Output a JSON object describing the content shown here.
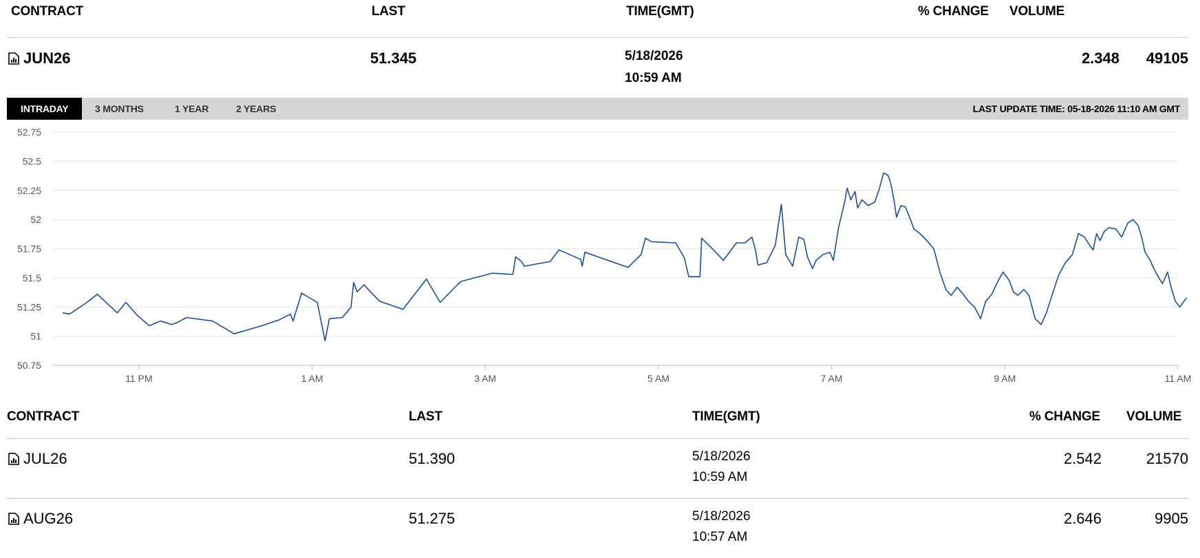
{
  "headers": {
    "contract": "CONTRACT",
    "last": "LAST",
    "time": "TIME(GMT)",
    "change": "% CHANGE",
    "volume": "VOLUME"
  },
  "main": {
    "contract": "JUN26",
    "last": "51.345",
    "date": "5/18/2026",
    "time": "10:59 AM",
    "change": "2.348",
    "volume": "49105"
  },
  "tabs": [
    {
      "label": "INTRADAY",
      "active": true
    },
    {
      "label": "3 MONTHS",
      "active": false
    },
    {
      "label": "1 YEAR",
      "active": false
    },
    {
      "label": "2 YEARS",
      "active": false
    }
  ],
  "last_update": "LAST UPDATE TIME: 05-18-2026 11:10 AM GMT",
  "rows": [
    {
      "contract": "JUL26",
      "last": "51.390",
      "date": "5/18/2026",
      "time": "10:59 AM",
      "change": "2.542",
      "volume": "21570"
    },
    {
      "contract": "AUG26",
      "last": "51.275",
      "date": "5/18/2026",
      "time": "10:57 AM",
      "change": "2.646",
      "volume": "9905"
    }
  ],
  "chart_data": {
    "type": "line",
    "yticks": [
      "52.75",
      "52.5",
      "52.25",
      "52",
      "51.75",
      "51.5",
      "51.25",
      "51",
      "50.75"
    ],
    "ylim": [
      50.75,
      52.75
    ],
    "xticks": [
      {
        "label": "11 PM",
        "t": 23
      },
      {
        "label": "1 AM",
        "t": 25
      },
      {
        "label": "3 AM",
        "t": 27
      },
      {
        "label": "5 AM",
        "t": 29
      },
      {
        "label": "7 AM",
        "t": 31
      },
      {
        "label": "9 AM",
        "t": 33
      },
      {
        "label": "11 AM",
        "t": 35
      }
    ],
    "x_unit": "hour (from previous day midnight GMT)",
    "xlim": [
      22.0,
      35.0
    ],
    "line_color": "#1f4e8c",
    "grid": true,
    "points": [
      [
        22.12,
        51.2
      ],
      [
        22.2,
        51.19
      ],
      [
        22.4,
        51.29
      ],
      [
        22.52,
        51.36
      ],
      [
        22.75,
        51.2
      ],
      [
        22.85,
        51.29
      ],
      [
        22.98,
        51.18
      ],
      [
        23.12,
        51.09
      ],
      [
        23.25,
        51.13
      ],
      [
        23.38,
        51.1
      ],
      [
        23.45,
        51.12
      ],
      [
        23.55,
        51.16
      ],
      [
        23.85,
        51.13
      ],
      [
        24.1,
        51.02
      ],
      [
        24.42,
        51.09
      ],
      [
        24.62,
        51.14
      ],
      [
        24.75,
        51.19
      ],
      [
        24.78,
        51.13
      ],
      [
        24.88,
        51.37
      ],
      [
        25.06,
        51.29
      ],
      [
        25.15,
        50.96
      ],
      [
        25.2,
        51.15
      ],
      [
        25.35,
        51.16
      ],
      [
        25.45,
        51.25
      ],
      [
        25.48,
        51.46
      ],
      [
        25.52,
        51.38
      ],
      [
        25.6,
        51.44
      ],
      [
        25.65,
        51.4
      ],
      [
        25.78,
        51.3
      ],
      [
        26.05,
        51.23
      ],
      [
        26.32,
        51.49
      ],
      [
        26.48,
        51.29
      ],
      [
        26.65,
        51.42
      ],
      [
        26.72,
        51.47
      ],
      [
        27.08,
        51.54
      ],
      [
        27.32,
        51.53
      ],
      [
        27.35,
        51.68
      ],
      [
        27.42,
        51.64
      ],
      [
        27.45,
        51.6
      ],
      [
        27.75,
        51.64
      ],
      [
        27.85,
        51.74
      ],
      [
        28.1,
        51.66
      ],
      [
        28.12,
        51.6
      ],
      [
        28.15,
        51.72
      ],
      [
        28.65,
        51.59
      ],
      [
        28.8,
        51.7
      ],
      [
        28.85,
        51.84
      ],
      [
        28.92,
        51.81
      ],
      [
        29.2,
        51.8
      ],
      [
        29.3,
        51.67
      ],
      [
        29.35,
        51.51
      ],
      [
        29.48,
        51.51
      ],
      [
        29.5,
        51.84
      ],
      [
        29.65,
        51.73
      ],
      [
        29.75,
        51.65
      ],
      [
        29.9,
        51.8
      ],
      [
        30.0,
        51.8
      ],
      [
        30.08,
        51.85
      ],
      [
        30.12,
        51.74
      ],
      [
        30.15,
        51.61
      ],
      [
        30.25,
        51.63
      ],
      [
        30.35,
        51.78
      ],
      [
        30.42,
        52.13
      ],
      [
        30.47,
        51.7
      ],
      [
        30.55,
        51.6
      ],
      [
        30.62,
        51.85
      ],
      [
        30.68,
        51.83
      ],
      [
        30.72,
        51.68
      ],
      [
        30.78,
        51.58
      ],
      [
        30.82,
        51.65
      ],
      [
        30.9,
        51.7
      ],
      [
        30.98,
        51.72
      ],
      [
        31.02,
        51.65
      ],
      [
        31.08,
        51.93
      ],
      [
        31.15,
        52.15
      ],
      [
        31.18,
        52.27
      ],
      [
        31.22,
        52.17
      ],
      [
        31.27,
        52.24
      ],
      [
        31.3,
        52.1
      ],
      [
        31.35,
        52.17
      ],
      [
        31.42,
        52.12
      ],
      [
        31.5,
        52.15
      ],
      [
        31.55,
        52.26
      ],
      [
        31.6,
        52.4
      ],
      [
        31.65,
        52.38
      ],
      [
        31.68,
        52.32
      ],
      [
        31.72,
        52.17
      ],
      [
        31.75,
        52.02
      ],
      [
        31.8,
        52.12
      ],
      [
        31.85,
        52.11
      ],
      [
        31.9,
        52.02
      ],
      [
        31.95,
        51.92
      ],
      [
        32.02,
        51.88
      ],
      [
        32.1,
        51.82
      ],
      [
        32.18,
        51.75
      ],
      [
        32.25,
        51.55
      ],
      [
        32.32,
        51.4
      ],
      [
        32.38,
        51.35
      ],
      [
        32.45,
        51.42
      ],
      [
        32.52,
        51.36
      ],
      [
        32.58,
        51.3
      ],
      [
        32.65,
        51.25
      ],
      [
        32.72,
        51.15
      ],
      [
        32.78,
        51.3
      ],
      [
        32.85,
        51.36
      ],
      [
        32.92,
        51.47
      ],
      [
        32.98,
        51.55
      ],
      [
        33.05,
        51.48
      ],
      [
        33.1,
        51.38
      ],
      [
        33.15,
        51.35
      ],
      [
        33.22,
        51.4
      ],
      [
        33.28,
        51.35
      ],
      [
        33.35,
        51.15
      ],
      [
        33.42,
        51.1
      ],
      [
        33.48,
        51.2
      ],
      [
        33.55,
        51.36
      ],
      [
        33.62,
        51.52
      ],
      [
        33.7,
        51.63
      ],
      [
        33.78,
        51.7
      ],
      [
        33.85,
        51.88
      ],
      [
        33.92,
        51.85
      ],
      [
        33.98,
        51.78
      ],
      [
        34.02,
        51.74
      ],
      [
        34.06,
        51.88
      ],
      [
        34.1,
        51.82
      ],
      [
        34.15,
        51.9
      ],
      [
        34.2,
        51.93
      ],
      [
        34.28,
        51.92
      ],
      [
        34.35,
        51.85
      ],
      [
        34.42,
        51.97
      ],
      [
        34.48,
        52.0
      ],
      [
        34.54,
        51.95
      ],
      [
        34.58,
        51.85
      ],
      [
        34.62,
        51.72
      ],
      [
        34.68,
        51.65
      ],
      [
        34.72,
        51.58
      ],
      [
        34.78,
        51.5
      ],
      [
        34.82,
        51.45
      ],
      [
        34.88,
        51.55
      ],
      [
        34.92,
        51.42
      ],
      [
        34.97,
        51.3
      ],
      [
        35.02,
        51.25
      ],
      [
        35.07,
        51.3
      ],
      [
        35.1,
        51.33
      ]
    ]
  }
}
